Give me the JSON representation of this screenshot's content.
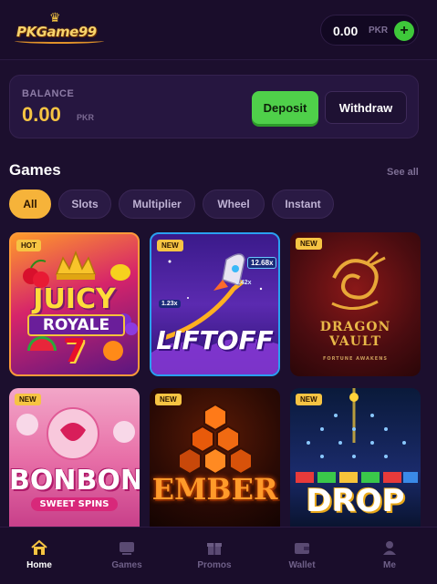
{
  "header": {
    "logo_text": "PKGame99",
    "wallet_amount": "0.00",
    "wallet_currency": "PKR",
    "wallet_add_icon": "plus-icon"
  },
  "balance": {
    "label": "BALANCE",
    "amount": "0.00",
    "currency": "PKR",
    "deposit_label": "Deposit",
    "withdraw_label": "Withdraw"
  },
  "games_section": {
    "title": "Games",
    "see_all": "See all",
    "filters": [
      {
        "label": "All",
        "active": true
      },
      {
        "label": "Slots",
        "active": false
      },
      {
        "label": "Multiplier",
        "active": false
      },
      {
        "label": "Wheel",
        "active": false
      },
      {
        "label": "Instant",
        "active": false
      }
    ],
    "tiles": [
      {
        "badge": "HOT",
        "line1": "JUICY",
        "line2": "ROYALE",
        "line3": "7"
      },
      {
        "badge": "NEW",
        "line1": "LIFTOFF",
        "mult1": "12.68x",
        "mult2": "3.42x",
        "mult3": "1.23x"
      },
      {
        "badge": "NEW",
        "line1": "DRAGON",
        "line2": "VAULT",
        "line3": "FORTUNE AWAKENS"
      },
      {
        "badge": "NEW",
        "line1": "BONBON",
        "line2": "SWEET SPINS"
      },
      {
        "badge": "NEW",
        "line1": "EMBER"
      },
      {
        "badge": "NEW",
        "line1": "DROP"
      }
    ]
  },
  "bottom_nav": [
    {
      "label": "Home",
      "icon": "home-icon",
      "active": true
    },
    {
      "label": "Games",
      "icon": "games-icon",
      "active": false
    },
    {
      "label": "Promos",
      "icon": "gift-icon",
      "active": false
    },
    {
      "label": "Wallet",
      "icon": "wallet-icon",
      "active": false
    },
    {
      "label": "Me",
      "icon": "user-icon",
      "active": false
    }
  ],
  "colors": {
    "background": "#1c0f2e",
    "accent_gold": "#f6c443",
    "accent_green": "#4fd04a",
    "active_filter": "#f6b33a"
  }
}
